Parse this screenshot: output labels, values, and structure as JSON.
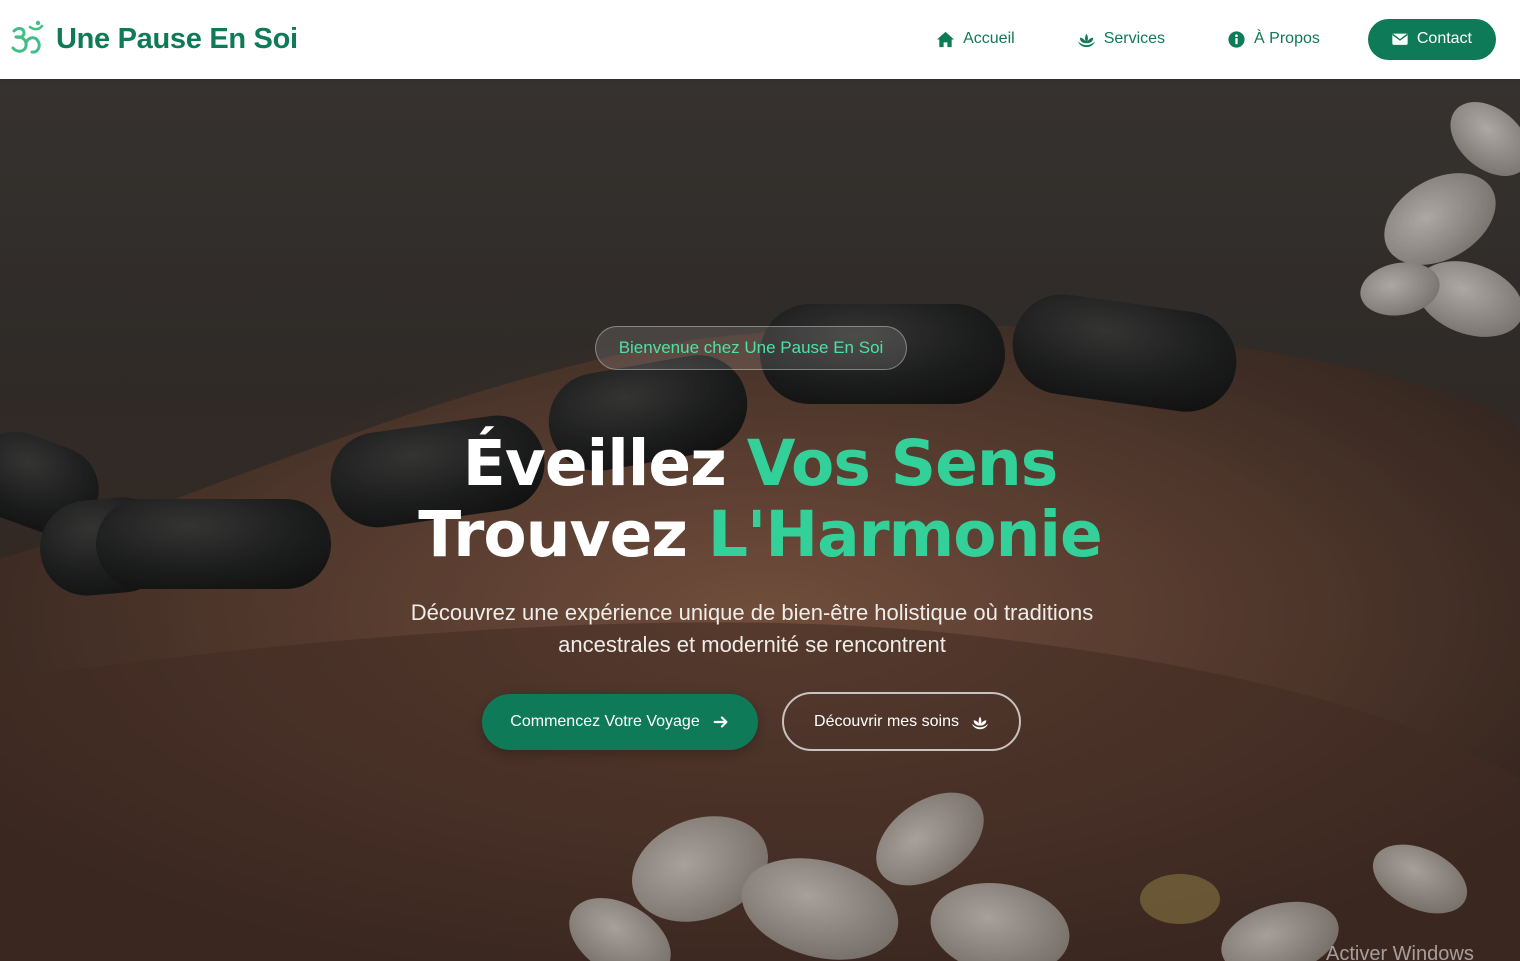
{
  "brand": {
    "name": "Une Pause En Soi",
    "icon": "om-icon"
  },
  "nav": {
    "items": [
      {
        "label": "Accueil",
        "icon": "home-icon"
      },
      {
        "label": "Services",
        "icon": "lotus-icon"
      },
      {
        "label": "À Propos",
        "icon": "info-icon"
      }
    ],
    "contact": {
      "label": "Contact",
      "icon": "envelope-icon"
    }
  },
  "hero": {
    "badge": "Bienvenue chez Une Pause En Soi",
    "line1": {
      "white": "Éveillez",
      "accent": "Vos Sens"
    },
    "line2": {
      "white": "Trouvez",
      "accent": "L'Harmonie"
    },
    "subtitle": "Découvrez une expérience unique de bien-être holistique où traditions ancestrales et modernité se rencontrent",
    "primary_button": {
      "label": "Commencez Votre Voyage",
      "icon": "arrow-right-icon"
    },
    "secondary_button": {
      "label": "Découvrir mes soins",
      "icon": "lotus-icon"
    }
  },
  "watermark": "Activer Windows",
  "colors": {
    "brand": "#0f7a57",
    "accent": "#33d199",
    "badge_text": "#4fe0a6"
  }
}
